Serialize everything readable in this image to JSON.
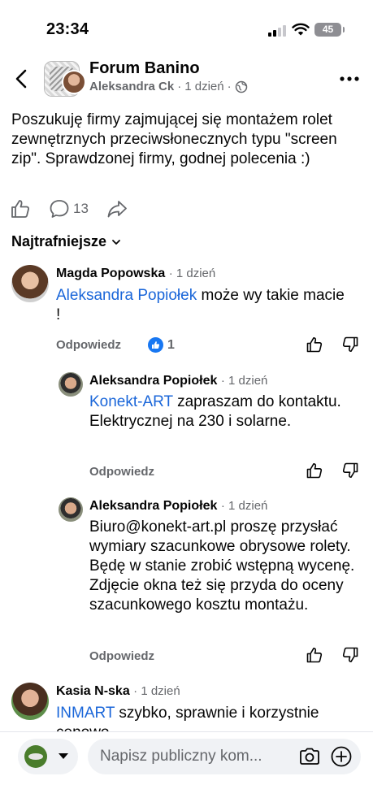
{
  "status_bar": {
    "time": "23:34",
    "battery": "45"
  },
  "header": {
    "group_name": "Forum Banino",
    "author": "Aleksandra Ck",
    "separator": "·",
    "time": "1 dzień"
  },
  "post": {
    "text": "Poszukuję firmy zajmującej się montażem rolet zewnętrznych przeciwsłonecznych typu \"screen zip\". Sprawdzonej firmy, godnej polecenia :)",
    "comment_count": "13"
  },
  "sort": {
    "label": "Najtrafniejsze"
  },
  "comments": [
    {
      "name": "Magda Popowska",
      "time": "· 1 dzień",
      "mention": "Aleksandra Popiołek",
      "text": " może wy takie macie !",
      "reply_label": "Odpowiedz",
      "like_count": "1"
    },
    {
      "name": "Aleksandra Popiołek",
      "time": "· 1 dzień",
      "mention": "Konekt-ART",
      "text": " zapraszam do kontaktu. Elektrycznej na 230 i solarne.",
      "reply_label": "Odpowiedz"
    },
    {
      "name": "Aleksandra Popiołek",
      "time": "· 1 dzień",
      "text": "Biuro@konekt-art.pl proszę przysłać wymiary szacunkowe obrysowe rolety. Będę w stanie zrobić wstępną wycenę. Zdjęcie okna też się przyda do oceny szacunkowego kosztu montażu.",
      "reply_label": "Odpowiedz"
    },
    {
      "name": "Kasia N-ska",
      "time": "· 1 dzień",
      "mention": "INMART",
      "text": " szybko, sprawnie i korzystnie cenowo"
    }
  ],
  "composer": {
    "placeholder": "Napisz publiczny kom..."
  },
  "colors": {
    "link": "#1a66d9",
    "secondary_text": "#65676b",
    "like_blue": "#1877f2"
  },
  "icons": [
    "back-arrow-icon",
    "globe-icon",
    "more-icon",
    "like-icon",
    "comment-icon",
    "share-icon",
    "chevron-down-icon",
    "dislike-icon",
    "camera-icon",
    "plus-circle-icon"
  ]
}
